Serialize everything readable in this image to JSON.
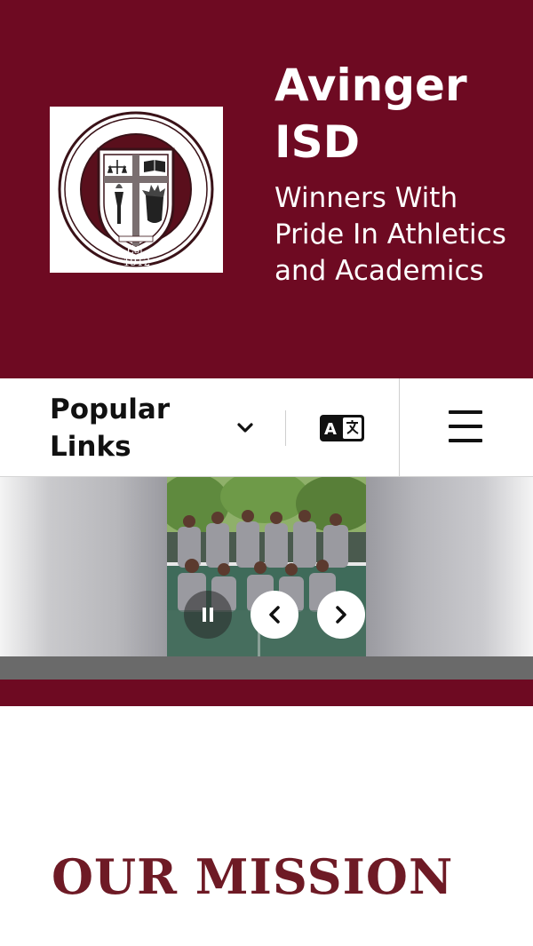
{
  "header": {
    "title": "Avinger ISD",
    "tagline": "Winners With Pride In Athletics and Academics",
    "logo": {
      "text_ring": "Avinger Independent School District",
      "established": "Est. 1912"
    },
    "background_color": "#6e0a22"
  },
  "nav": {
    "popular_links_label": "Popular Links",
    "dropdown_icon": "chevron-down-icon",
    "translate_icon": "translate-icon",
    "menu_icon": "hamburger-menu-icon"
  },
  "slider": {
    "controls": {
      "pause_icon": "pause-icon",
      "prev_icon": "chevron-left-icon",
      "next_icon": "chevron-right-icon"
    }
  },
  "mission": {
    "heading": "OUR MISSION",
    "color": "#6e1a25"
  }
}
